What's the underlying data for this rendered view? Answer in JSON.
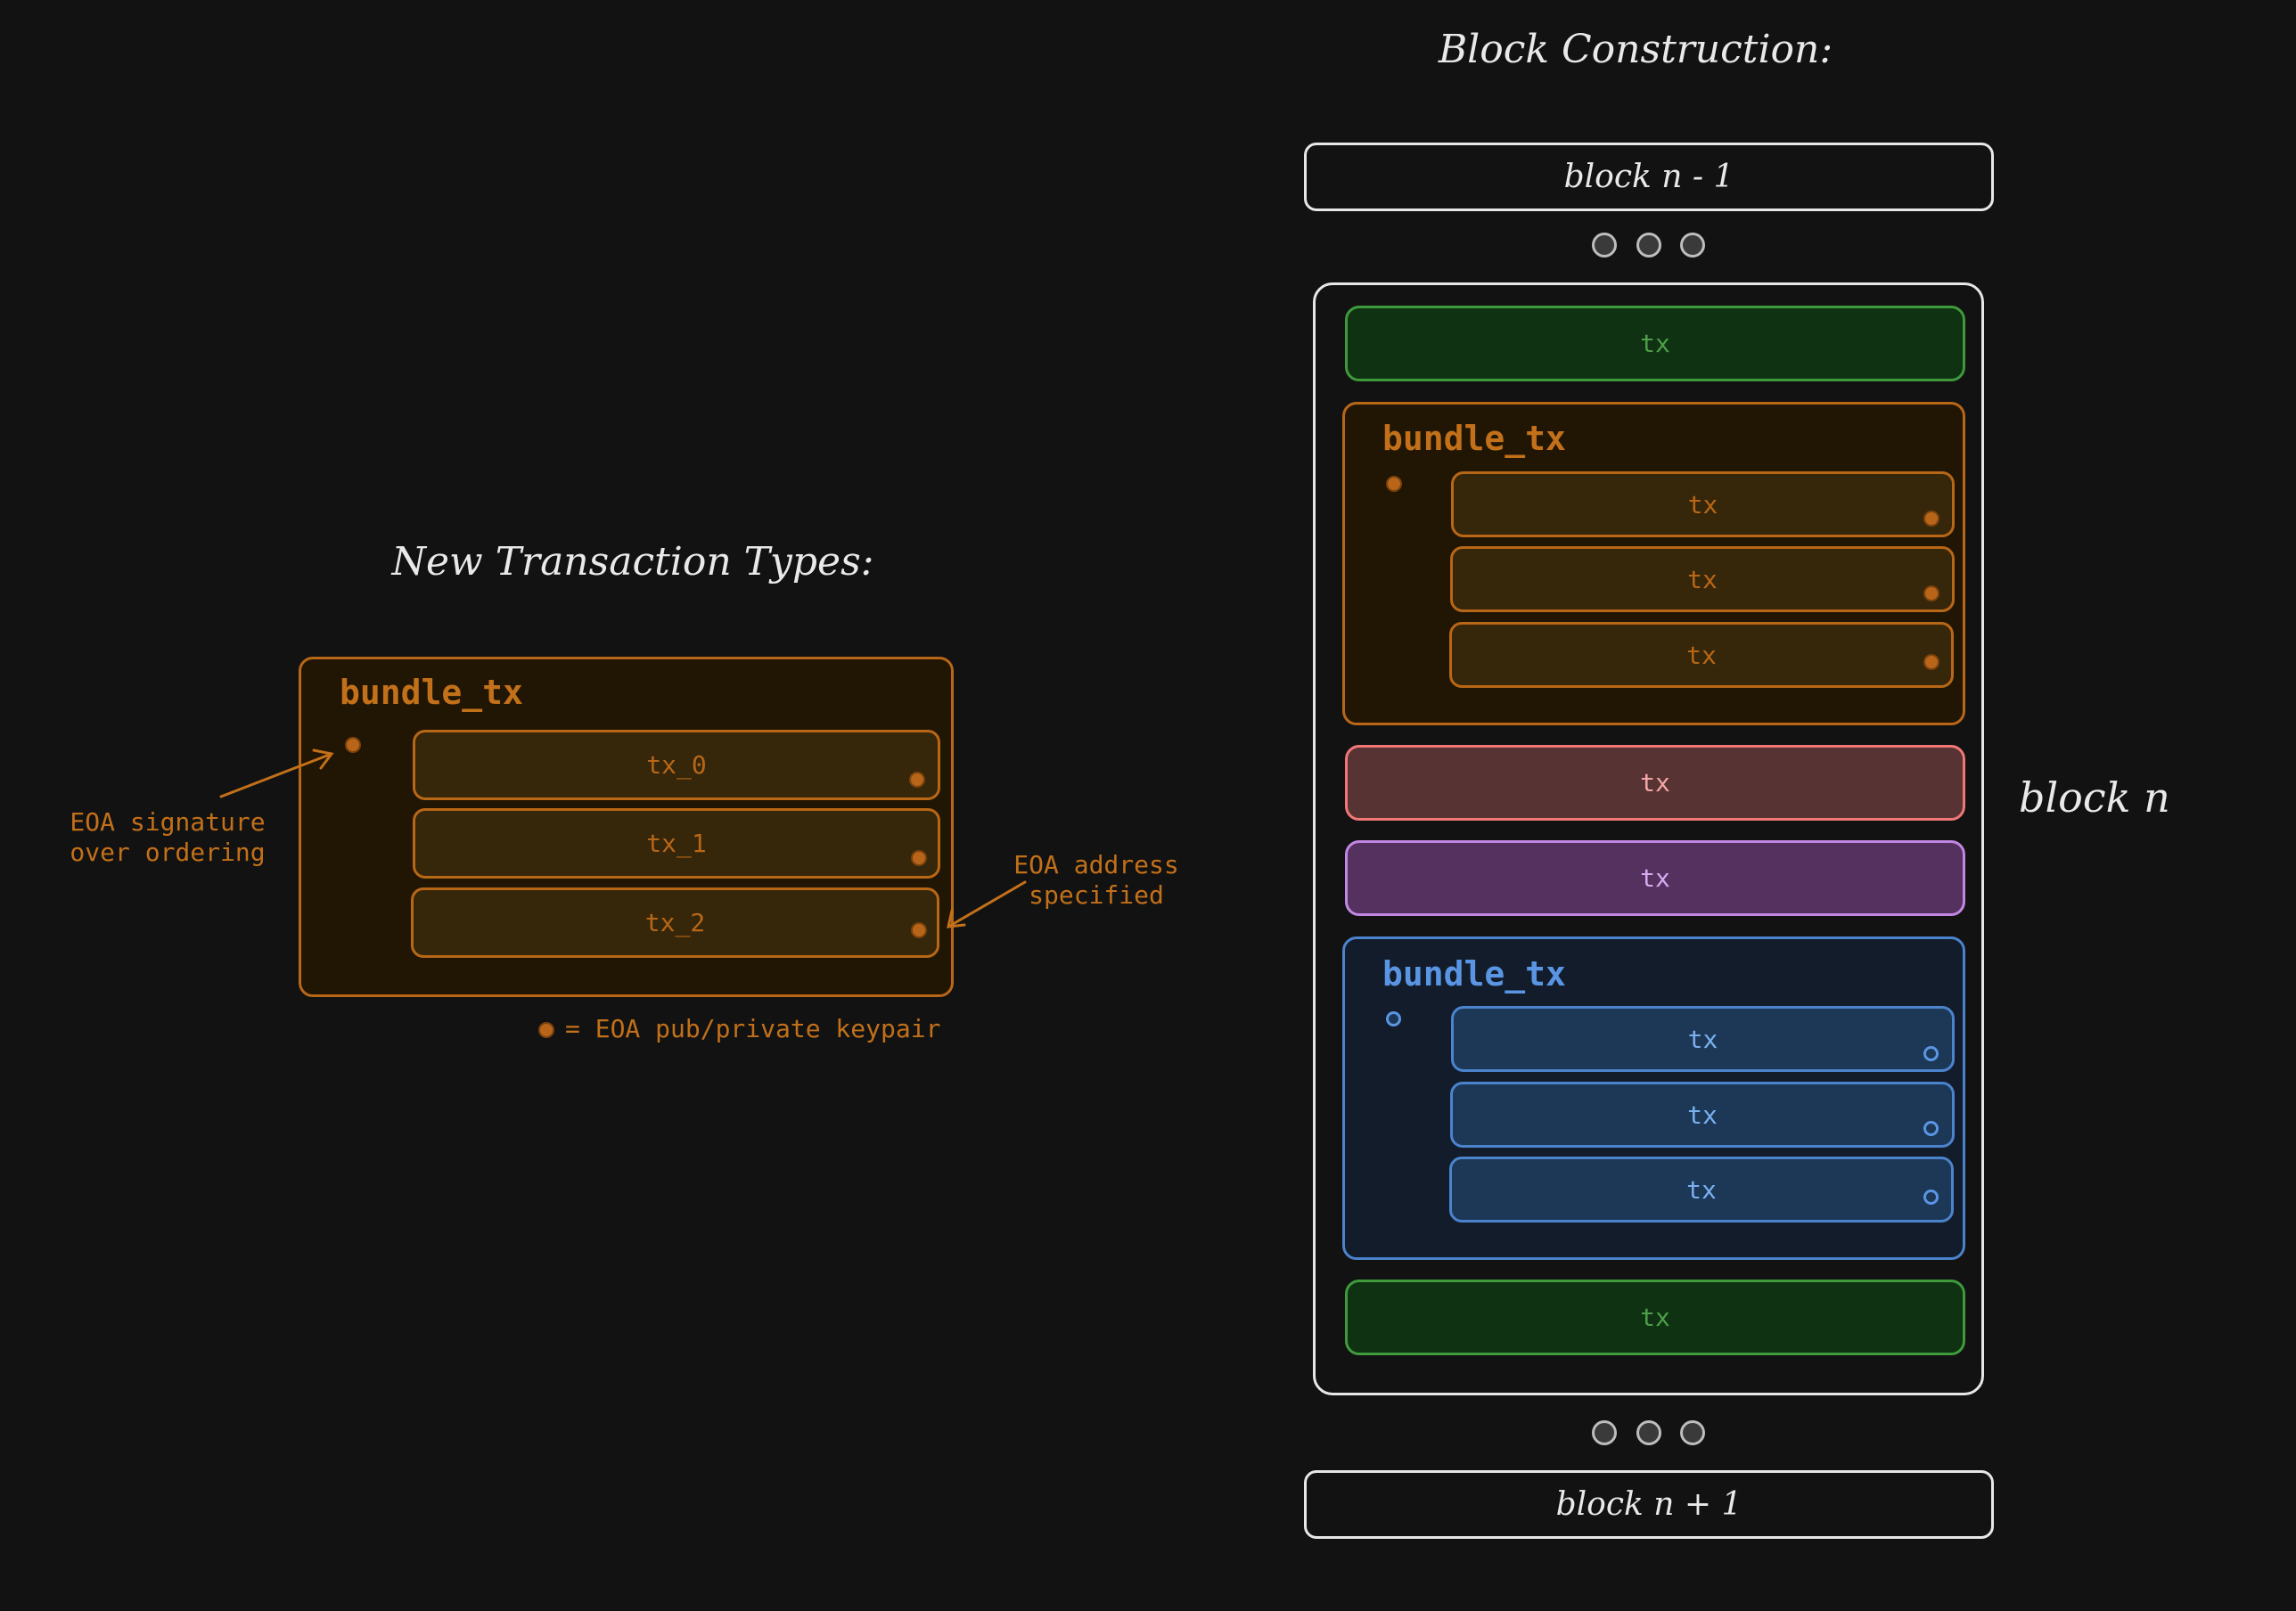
{
  "left": {
    "title": "New Transaction Types:",
    "bundle_label": "bundle_tx",
    "txs": [
      "tx_0",
      "tx_1",
      "tx_2"
    ],
    "note_signature_1": "EOA signature",
    "note_signature_2": "over ordering",
    "note_address_1": "EOA address",
    "note_address_2": "specified",
    "legend": "= EOA pub/private keypair"
  },
  "right": {
    "title": "Block Construction:",
    "block_prev": "block n - 1",
    "block_next": "block n + 1",
    "block_current": "block n",
    "tx_label": "tx",
    "bundle_label": "bundle_tx"
  },
  "colors": {
    "orange": "#b86716",
    "blue": "#4b83cd",
    "green": "#3f9a3c",
    "red": "#f27777",
    "purple": "#c187e2",
    "background": "#121212"
  }
}
